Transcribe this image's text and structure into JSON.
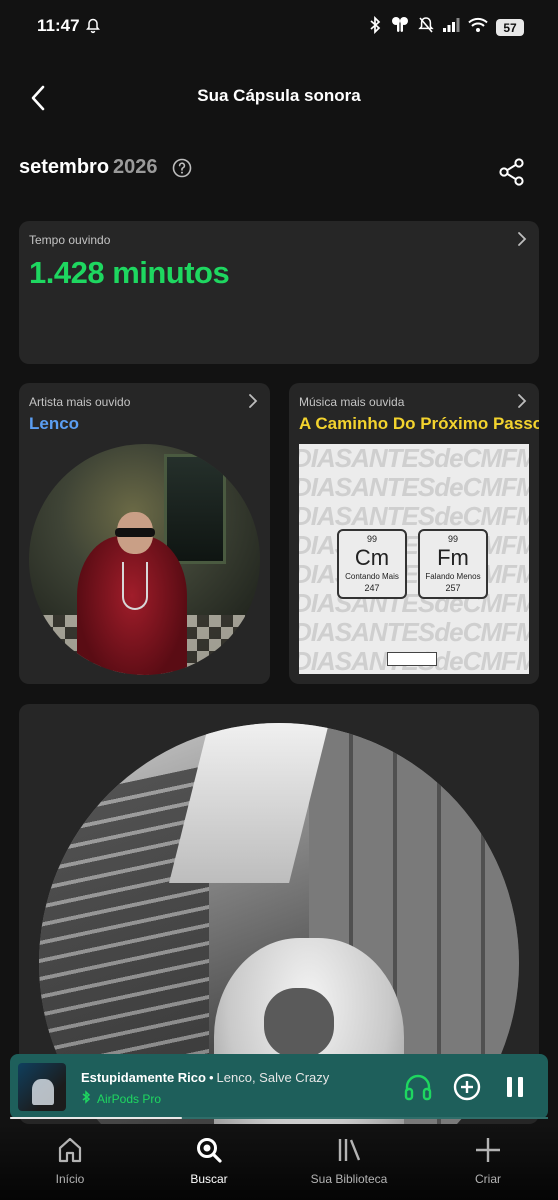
{
  "status_bar": {
    "time": "11:47",
    "battery": "57"
  },
  "header": {
    "title": "Sua Cápsula sonora"
  },
  "period": {
    "month": "setembro",
    "year": "2026"
  },
  "time_card": {
    "label": "Tempo ouvindo",
    "value": "1.428 minutos"
  },
  "artist_card": {
    "label": "Artista mais ouvido",
    "name": "Lenco"
  },
  "song_card": {
    "label": "Música mais ouvida",
    "name": "A Caminho Do Próximo Passo",
    "art_rows": [
      "DIASANTESdeCMFM",
      "DIASANTESdeCMFM",
      "DIASANTESdeCMFM",
      "DIASANTESdeCMFM",
      "DIASANTESdeCMFM",
      "DIASANTESdeCMFM",
      "DIASANTESdeCMFM",
      "DIASANTESdeCMFM"
    ],
    "elements": [
      {
        "number": "99",
        "symbol": "Cm",
        "name": "Contando Mais",
        "mass": "247"
      },
      {
        "number": "99",
        "symbol": "Fm",
        "name": "Falando Menos",
        "mass": "257"
      }
    ]
  },
  "player": {
    "title": "Estupidamente Rico",
    "separator": "•",
    "artists": "Lenco, Salve Crazy",
    "device": "AirPods Pro",
    "progress_fraction": 0.32
  },
  "nav": {
    "items": [
      {
        "label": "Início",
        "icon": "home-icon"
      },
      {
        "label": "Buscar",
        "icon": "search-icon"
      },
      {
        "label": "Sua Biblioteca",
        "icon": "library-icon"
      },
      {
        "label": "Criar",
        "icon": "plus-icon"
      }
    ],
    "active": "Buscar"
  },
  "colors": {
    "accent_green": "#1ed760",
    "artist_blue": "#5b9ef2",
    "song_yellow": "#f3d32e",
    "player_bg": "#1e5f5b"
  }
}
